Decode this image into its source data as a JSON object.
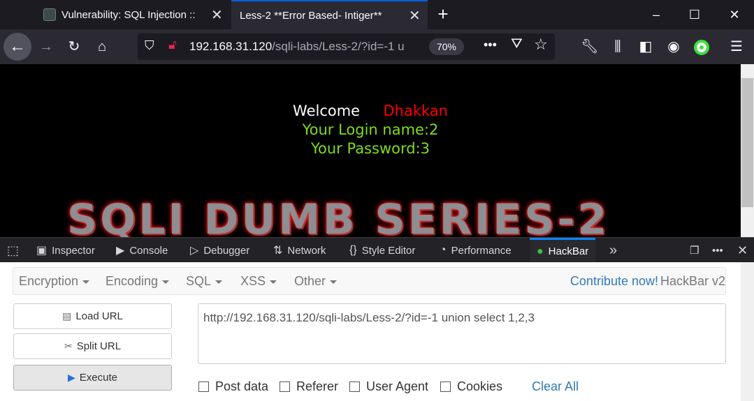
{
  "tabs": [
    {
      "title": "Vulnerability: SQL Injection :: ",
      "active": false
    },
    {
      "title": "Less-2 **Error Based- Intiger**",
      "active": true
    }
  ],
  "window": {
    "minimize": "–",
    "maximize": "☐",
    "close": "✕"
  },
  "navbar": {
    "url_host": "192.168.31.120",
    "url_path": "/sqli-labs/Less-2/?id=-1 u",
    "zoom": "70%"
  },
  "page": {
    "welcome": "Welcome",
    "user": "Dhakkan",
    "login_line": "Your Login name:2",
    "password_line": "Your Password:3",
    "banner": "SQLI DUMB SERIES-2"
  },
  "devtools": {
    "tabs": [
      "Inspector",
      "Console",
      "Debugger",
      "Network",
      "Style Editor",
      "Performance",
      "HackBar"
    ]
  },
  "hackbar": {
    "menus": [
      "Encryption",
      "Encoding",
      "SQL",
      "XSS",
      "Other"
    ],
    "contribute": "Contribute now!",
    "version": "HackBar v2",
    "buttons": {
      "load": "Load URL",
      "split": "Split URL",
      "execute": "Execute"
    },
    "url_value": "http://192.168.31.120/sqli-labs/Less-2/?id=-1 union select 1,2,3",
    "checkboxes": [
      "Post data",
      "Referer",
      "User Agent",
      "Cookies"
    ],
    "clear_all": "Clear All"
  },
  "colors": {
    "accent": "#0060df",
    "user_red": "#ff0000",
    "green_text": "#7fdc1f",
    "link": "#337ab7"
  }
}
